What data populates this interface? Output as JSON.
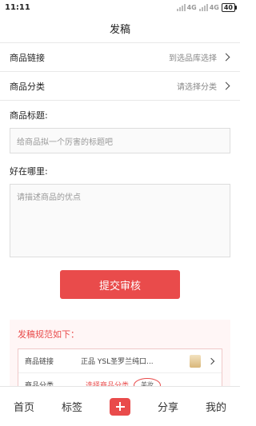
{
  "status": {
    "time": "11:11",
    "signal_labels": [
      "4G",
      "4G"
    ],
    "battery": "40"
  },
  "header": {
    "title": "发稿"
  },
  "rows": [
    {
      "label": "商品链接",
      "value": "到选品库选择"
    },
    {
      "label": "商品分类",
      "value": "请选择分类"
    }
  ],
  "title_field": {
    "label": "商品标题:",
    "placeholder": "给商品拟一个厉害的标题吧"
  },
  "desc_field": {
    "label": "好在哪里:",
    "placeholder": "请描述商品的优点"
  },
  "submit": {
    "label": "提交审核"
  },
  "rules": {
    "title": "发稿规范如下：",
    "row1": {
      "label": "商品链接",
      "value": "正品 YSL圣罗兰纯口..."
    },
    "row2": {
      "label": "商品分类",
      "hint": "选择商品分类",
      "circle": "美妆"
    }
  },
  "tabbar": {
    "home": "首页",
    "tags": "标签",
    "share": "分享",
    "mine": "我的"
  },
  "colors": {
    "accent": "#e94b4b"
  }
}
